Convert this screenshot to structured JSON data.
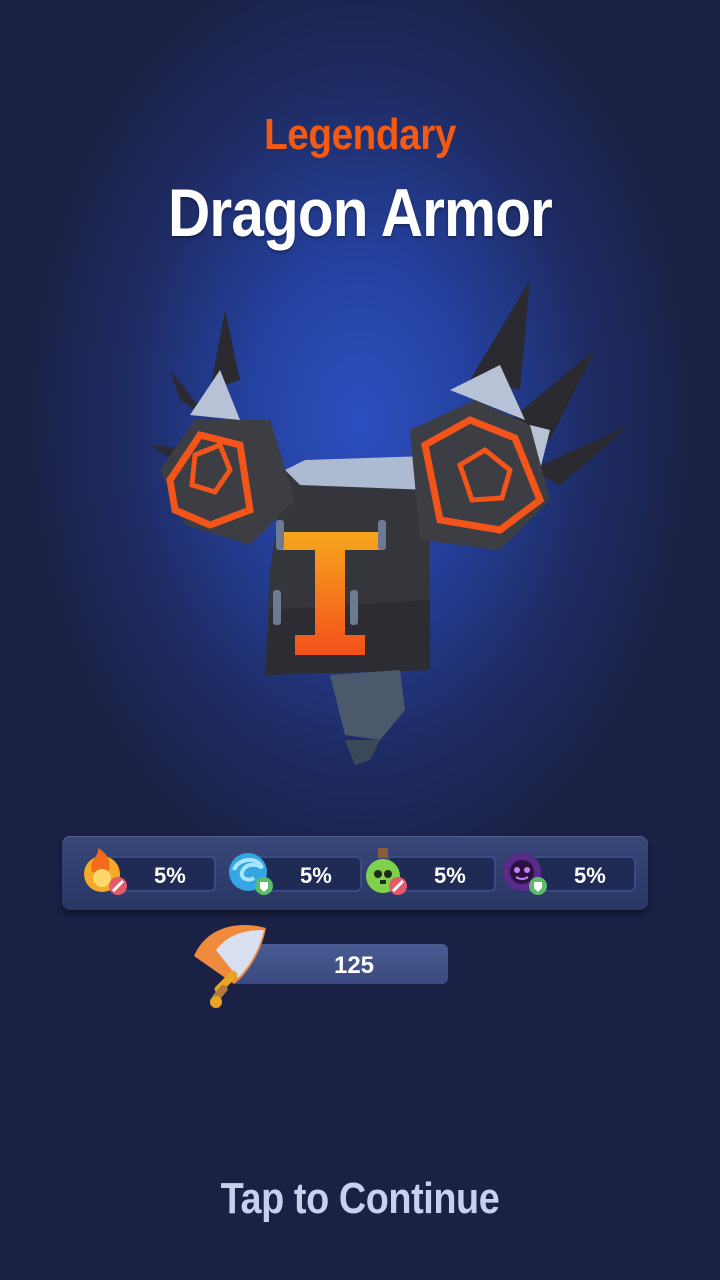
{
  "item": {
    "rarity": "Legendary",
    "name": "Dragon Armor"
  },
  "colors": {
    "rarity": "#f45a12",
    "background": "#1a2145",
    "glow": "#2d4fc0"
  },
  "resistances": [
    {
      "icon": "fire-attack-icon",
      "value": "5%"
    },
    {
      "icon": "water-defense-icon",
      "value": "5%"
    },
    {
      "icon": "poison-attack-icon",
      "value": "5%"
    },
    {
      "icon": "dark-defense-icon",
      "value": "5%"
    }
  ],
  "power": {
    "icon": "sword-icon",
    "value": "125"
  },
  "footer": {
    "prompt": "Tap to Continue"
  }
}
